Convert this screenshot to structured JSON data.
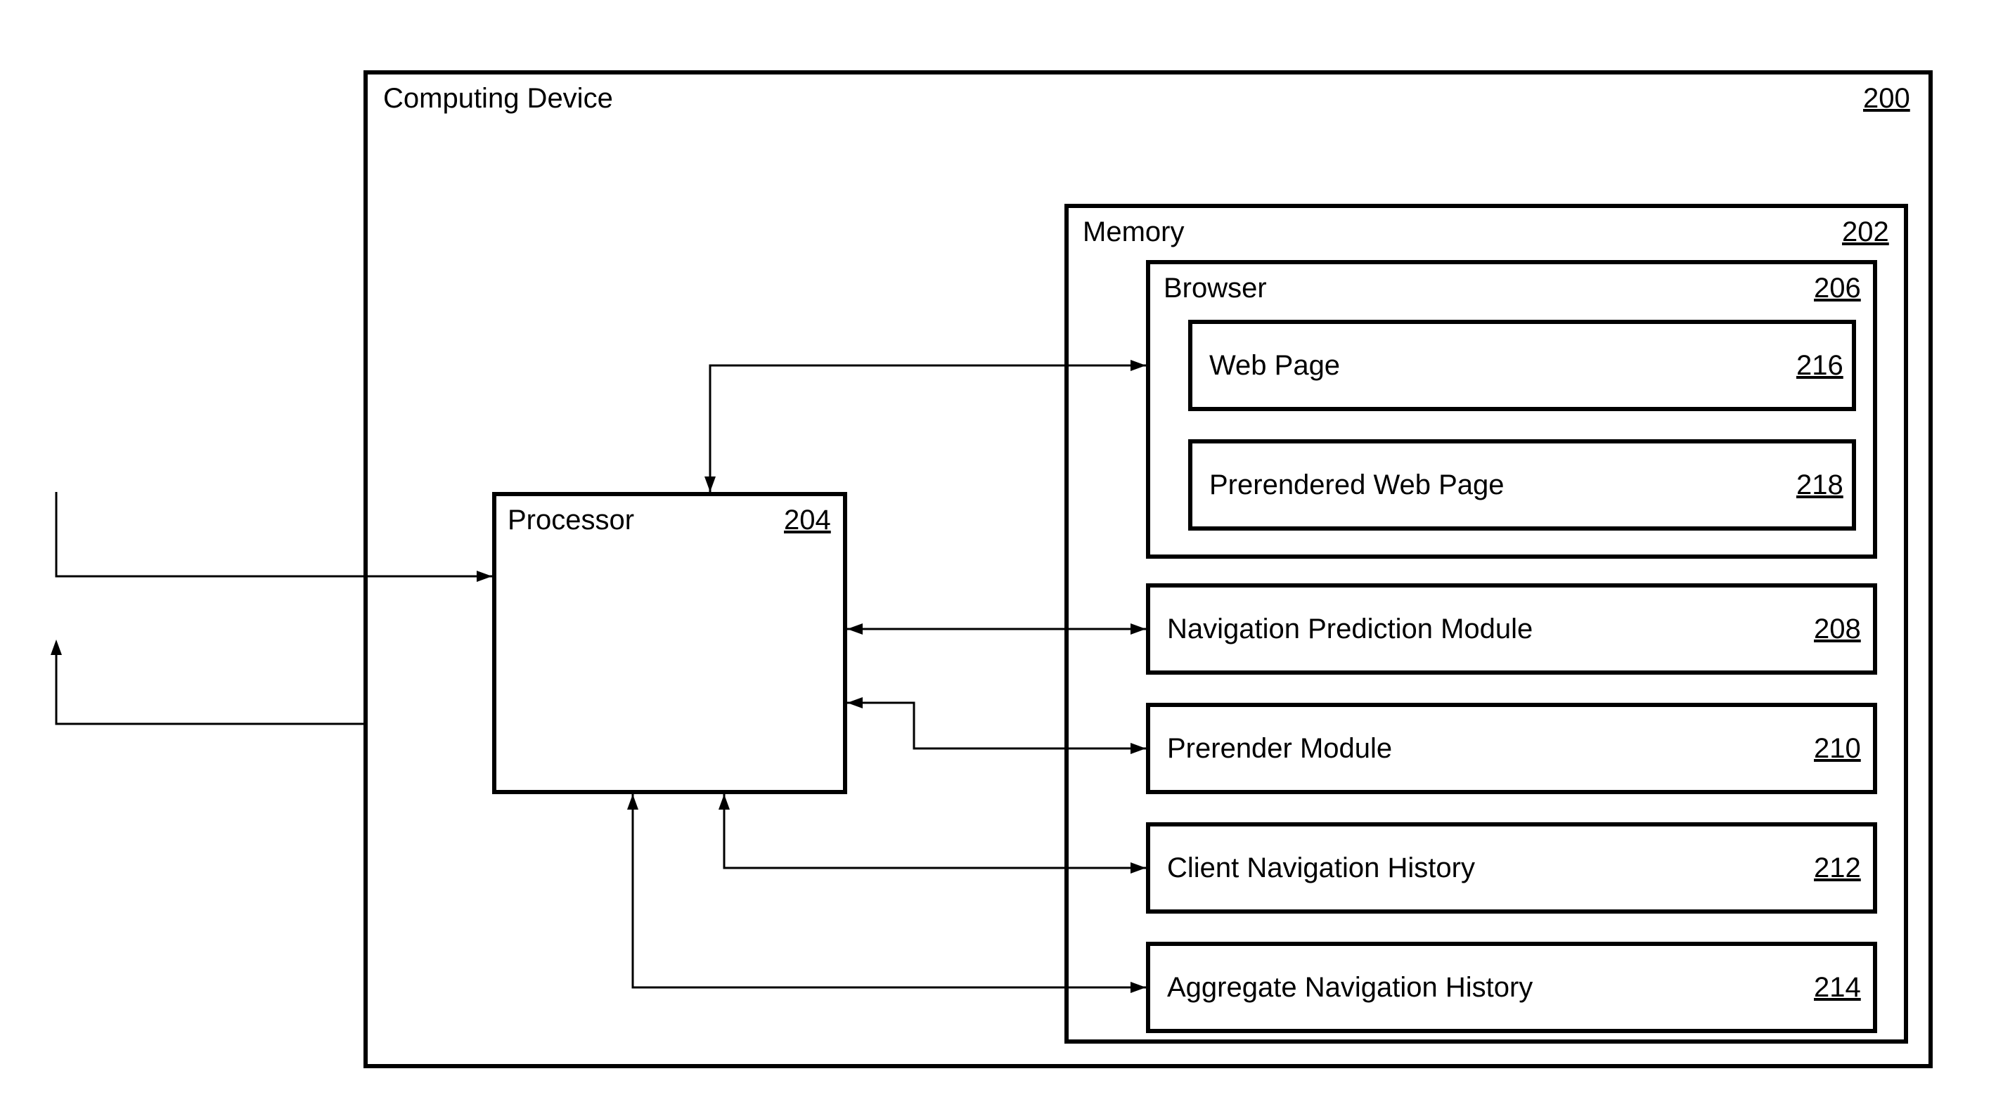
{
  "device": {
    "title": "Computing Device",
    "ref": "200"
  },
  "processor": {
    "title": "Processor",
    "ref": "204"
  },
  "memory": {
    "title": "Memory",
    "ref": "202"
  },
  "browser": {
    "title": "Browser",
    "ref": "206"
  },
  "webpage": {
    "title": "Web Page",
    "ref": "216"
  },
  "prerendered": {
    "title": "Prerendered Web Page",
    "ref": "218"
  },
  "navpred": {
    "title": "Navigation Prediction Module",
    "ref": "208"
  },
  "prerender_mod": {
    "title": "Prerender Module",
    "ref": "210"
  },
  "client_hist": {
    "title": "Client Navigation History",
    "ref": "212"
  },
  "agg_hist": {
    "title": "Aggregate Navigation History",
    "ref": "214"
  }
}
